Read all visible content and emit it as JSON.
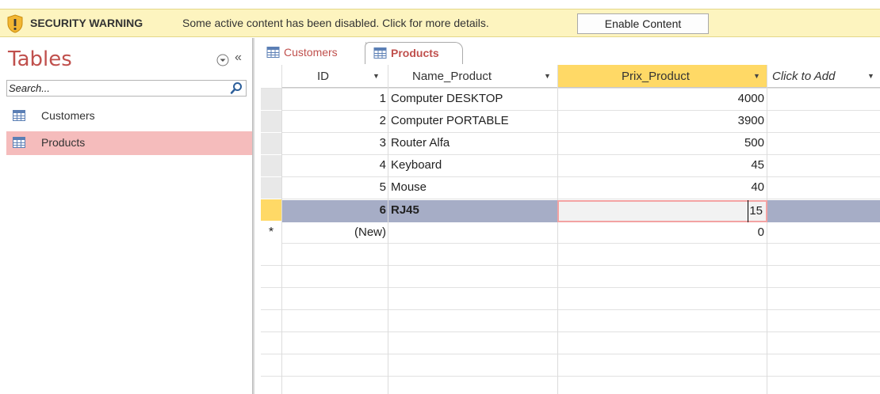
{
  "security_bar": {
    "title": "SECURITY WARNING",
    "message": "Some active content has been disabled. Click for more details.",
    "button_label": "Enable Content"
  },
  "nav": {
    "heading": "Tables",
    "search_placeholder": "Search...",
    "collapse_glyph": "«",
    "items": [
      {
        "label": "Customers",
        "selected": false
      },
      {
        "label": "Products",
        "selected": true
      }
    ]
  },
  "tabs": [
    {
      "label": "Customers",
      "active": false
    },
    {
      "label": "Products",
      "active": true
    }
  ],
  "datasheet": {
    "columns": [
      {
        "label": "ID",
        "arrow": "▼"
      },
      {
        "label": "Name_Product",
        "arrow": "▼"
      },
      {
        "label": "Prix_Product",
        "arrow": "▼"
      },
      {
        "label": "Click to Add",
        "arrow": "▼"
      }
    ],
    "rows": [
      {
        "id": "1",
        "name": "Computer DESKTOP",
        "prix": "4000"
      },
      {
        "id": "2",
        "name": "Computer PORTABLE",
        "prix": "3900"
      },
      {
        "id": "3",
        "name": "Router Alfa",
        "prix": "500"
      },
      {
        "id": "4",
        "name": "Keyboard",
        "prix": "45"
      },
      {
        "id": "5",
        "name": "Mouse",
        "prix": "40"
      },
      {
        "id": "6",
        "name": "RJ45",
        "prix": "15"
      }
    ],
    "new_row": {
      "selector": "*",
      "id": "(New)",
      "prix": "0"
    }
  },
  "colors": {
    "accent": "#c0504d",
    "warning_bg": "#fdf4bf",
    "selected_nav": "#f5bcbc",
    "selected_header": "#ffd966",
    "selected_row": "#a6adc6"
  },
  "icons": [
    "shield-warning-icon",
    "table-icon",
    "search-icon",
    "menu-dropdown-icon",
    "collapse-icon",
    "dropdown-arrow-icon"
  ]
}
